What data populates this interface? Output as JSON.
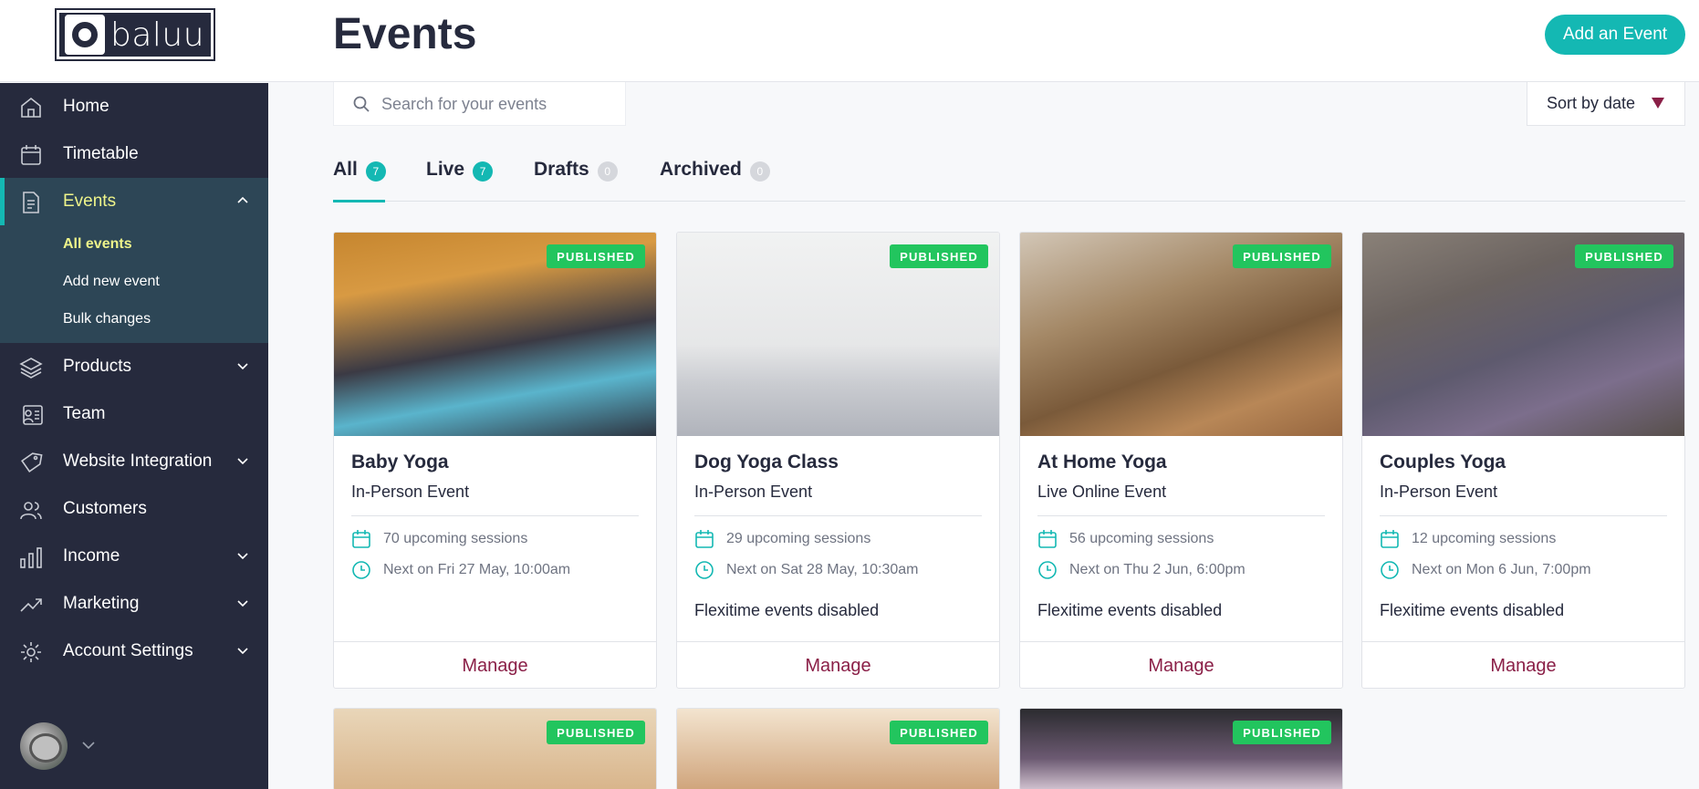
{
  "header": {
    "logo_text": "baluu",
    "title": "Events",
    "add_event_label": "Add an Event"
  },
  "sidebar": {
    "items": [
      {
        "label": "Home",
        "icon": "home-icon"
      },
      {
        "label": "Timetable",
        "icon": "calendar-icon"
      },
      {
        "label": "Events",
        "icon": "document-icon",
        "active": true,
        "expanded": true
      },
      {
        "label": "Products",
        "icon": "layers-icon",
        "has_children": true
      },
      {
        "label": "Team",
        "icon": "id-card-icon"
      },
      {
        "label": "Website Integration",
        "icon": "tag-icon",
        "has_children": true
      },
      {
        "label": "Customers",
        "icon": "users-icon"
      },
      {
        "label": "Income",
        "icon": "bar-chart-icon",
        "has_children": true
      },
      {
        "label": "Marketing",
        "icon": "trend-icon",
        "has_children": true
      },
      {
        "label": "Account Settings",
        "icon": "gear-icon",
        "has_children": true
      }
    ],
    "events_submenu": [
      {
        "label": "All events",
        "active": true
      },
      {
        "label": "Add new event"
      },
      {
        "label": "Bulk changes"
      }
    ]
  },
  "search": {
    "placeholder": "Search for your events",
    "value": ""
  },
  "sort": {
    "label": "Sort by date"
  },
  "tabs": [
    {
      "label": "All",
      "count": "7",
      "active": true
    },
    {
      "label": "Live",
      "count": "7"
    },
    {
      "label": "Drafts",
      "count": "0"
    },
    {
      "label": "Archived",
      "count": "0"
    }
  ],
  "cards": [
    {
      "badge": "PUBLISHED",
      "title": "Baby Yoga",
      "type": "In-Person Event",
      "sessions": "70 upcoming sessions",
      "next": "Next on Fri 27 May, 10:00am",
      "flexi": "",
      "manage": "Manage"
    },
    {
      "badge": "PUBLISHED",
      "title": "Dog Yoga Class",
      "type": "In-Person Event",
      "sessions": "29 upcoming sessions",
      "next": "Next on Sat 28 May, 10:30am",
      "flexi": "Flexitime events disabled",
      "manage": "Manage"
    },
    {
      "badge": "PUBLISHED",
      "title": "At Home Yoga",
      "type": "Live Online Event",
      "sessions": "56 upcoming sessions",
      "next": "Next on Thu 2 Jun, 6:00pm",
      "flexi": "Flexitime events disabled",
      "manage": "Manage"
    },
    {
      "badge": "PUBLISHED",
      "title": "Couples Yoga",
      "type": "In-Person Event",
      "sessions": "12 upcoming sessions",
      "next": "Next on Mon 6 Jun, 7:00pm",
      "flexi": "Flexitime events disabled",
      "manage": "Manage"
    }
  ],
  "partial_cards": [
    {
      "badge": "PUBLISHED"
    },
    {
      "badge": "PUBLISHED"
    },
    {
      "badge": "PUBLISHED"
    }
  ],
  "colors": {
    "accent": "#14b8b3",
    "sidebar_bg": "#262a3d",
    "sidebar_active_bg": "#2d4656",
    "sidebar_active_text": "#eef48a",
    "manage_link": "#8a1f47",
    "published_badge": "#22c55e"
  }
}
